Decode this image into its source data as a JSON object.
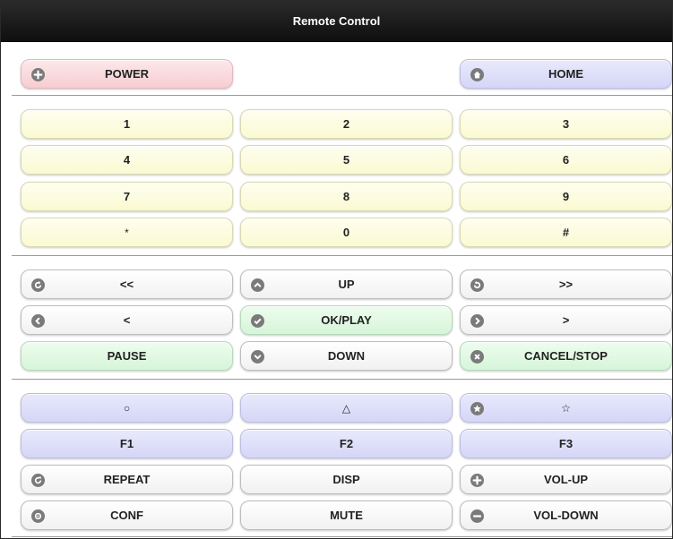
{
  "titlebar": {
    "title": "Remote Control"
  },
  "top": {
    "power": "POWER",
    "home": "HOME"
  },
  "keypad": [
    "1",
    "2",
    "3",
    "4",
    "5",
    "6",
    "7",
    "8",
    "9",
    "*",
    "0",
    "#"
  ],
  "nav": {
    "rewind": "<<",
    "up": "UP",
    "forward": ">>",
    "left": "<",
    "ok": "OK/PLAY",
    "right": ">",
    "pause": "PAUSE",
    "down": "DOWN",
    "cancel": "CANCEL/STOP"
  },
  "func": {
    "circle": "○",
    "triangle": "△",
    "star": "☆",
    "f1": "F1",
    "f2": "F2",
    "f3": "F3",
    "repeat": "REPEAT",
    "disp": "DISP",
    "vol_up": "VOL-UP",
    "conf": "CONF",
    "mute": "MUTE",
    "vol_down": "VOL-DOWN"
  },
  "colors": {
    "titlebar": "#1a1a1a",
    "pink": "#f8d6da",
    "lavender": "#dcdcf8",
    "yellow": "#fbfbdc",
    "green": "#ddf6df",
    "white": "#f7f7f7",
    "icon": "#7a7a7a"
  },
  "icons": [
    "plus-icon",
    "home-icon",
    "back-icon",
    "up-icon",
    "forward-icon",
    "left-icon",
    "check-icon",
    "right-icon",
    "down-icon",
    "delete-icon",
    "star-icon",
    "refresh-icon",
    "plus-icon",
    "gear-icon",
    "minus-icon"
  ]
}
